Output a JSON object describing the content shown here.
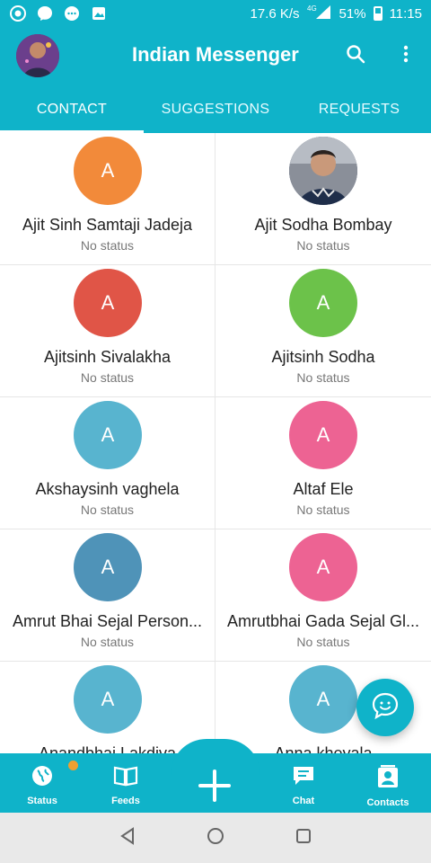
{
  "status_bar": {
    "speed": "17.6 K/s",
    "network": "4G",
    "battery": "51%",
    "time": "11:15",
    "icons": [
      "whatsapp-icon",
      "messenger-icon",
      "chat-bubble-icon",
      "image-icon"
    ]
  },
  "app_bar": {
    "title": "Indian Messenger",
    "actions": [
      "search-icon",
      "more-vert-icon"
    ]
  },
  "tabs": [
    {
      "label": "CONTACT",
      "active": true
    },
    {
      "label": "SUGGESTIONS",
      "active": false
    },
    {
      "label": "REQUESTS",
      "active": false
    }
  ],
  "contacts": [
    {
      "name": "Ajit Sinh Samtaji  Jadeja",
      "status": "No status",
      "initial": "A",
      "color": "#f28a3a"
    },
    {
      "name": "Ajit Sodha Bombay",
      "status": "No status",
      "initial": "",
      "color": "#3b4a6b"
    },
    {
      "name": "Ajitsinh Sivalakha",
      "status": "No status",
      "initial": "A",
      "color": "#e05547"
    },
    {
      "name": "Ajitsinh Sodha",
      "status": "No status",
      "initial": "A",
      "color": "#6cc24a"
    },
    {
      "name": "Akshaysinh vaghela",
      "status": "No status",
      "initial": "A",
      "color": "#58b4cf"
    },
    {
      "name": "Altaf Ele",
      "status": "No status",
      "initial": "A",
      "color": "#ed6393"
    },
    {
      "name": "Amrut Bhai Sejal Person...",
      "status": "No status",
      "initial": "A",
      "color": "#4f93b8"
    },
    {
      "name": "Amrutbhai Gada Sejal Gl...",
      "status": "No status",
      "initial": "A",
      "color": "#ed6393"
    },
    {
      "name": "Anandbhai Lakdiva",
      "status": "",
      "initial": "A",
      "color": "#58b4cf"
    },
    {
      "name": "Anna kheyala",
      "status": "",
      "initial": "A",
      "color": "#58b4cf"
    }
  ],
  "bottom_nav": [
    {
      "label": "Status",
      "icon": "globe-icon"
    },
    {
      "label": "Feeds",
      "icon": "book-icon"
    },
    {
      "label": "",
      "icon": "plus-icon"
    },
    {
      "label": "Chat",
      "icon": "chat-icon"
    },
    {
      "label": "Contacts",
      "icon": "contacts-icon"
    }
  ],
  "colors": {
    "accent": "#0fb3c9",
    "badge": "#f0a030"
  }
}
